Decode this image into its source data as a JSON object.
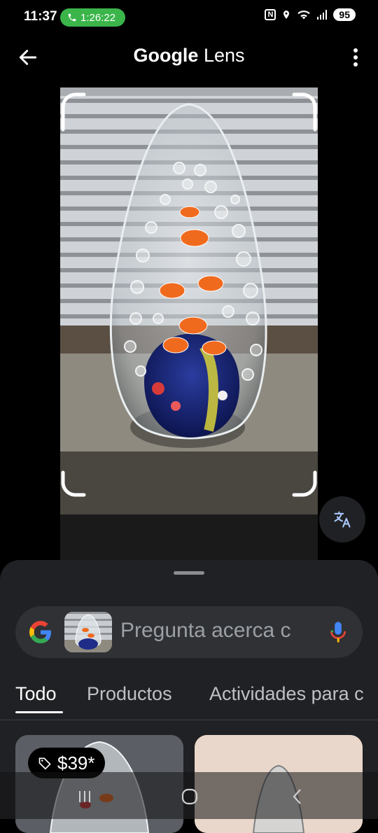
{
  "status": {
    "time": "11:37",
    "call_duration": "1:26:22",
    "battery": "95"
  },
  "header": {
    "title_brand": "Google",
    "title_product": "Lens"
  },
  "search": {
    "placeholder": "Pregunta acerca c"
  },
  "tabs": [
    {
      "label": "Todo"
    },
    {
      "label": "Productos"
    },
    {
      "label": "Actividades para c"
    }
  ],
  "results": [
    {
      "price": "$39*"
    }
  ],
  "icons": {
    "back": "arrow-left-icon",
    "more": "more-vert-icon",
    "translate": "translate-icon",
    "mic": "mic-icon",
    "tag": "tag-icon",
    "phone": "phone-icon"
  },
  "colors": {
    "accent_green": "#3bb54a",
    "sheet_bg": "#202124"
  }
}
